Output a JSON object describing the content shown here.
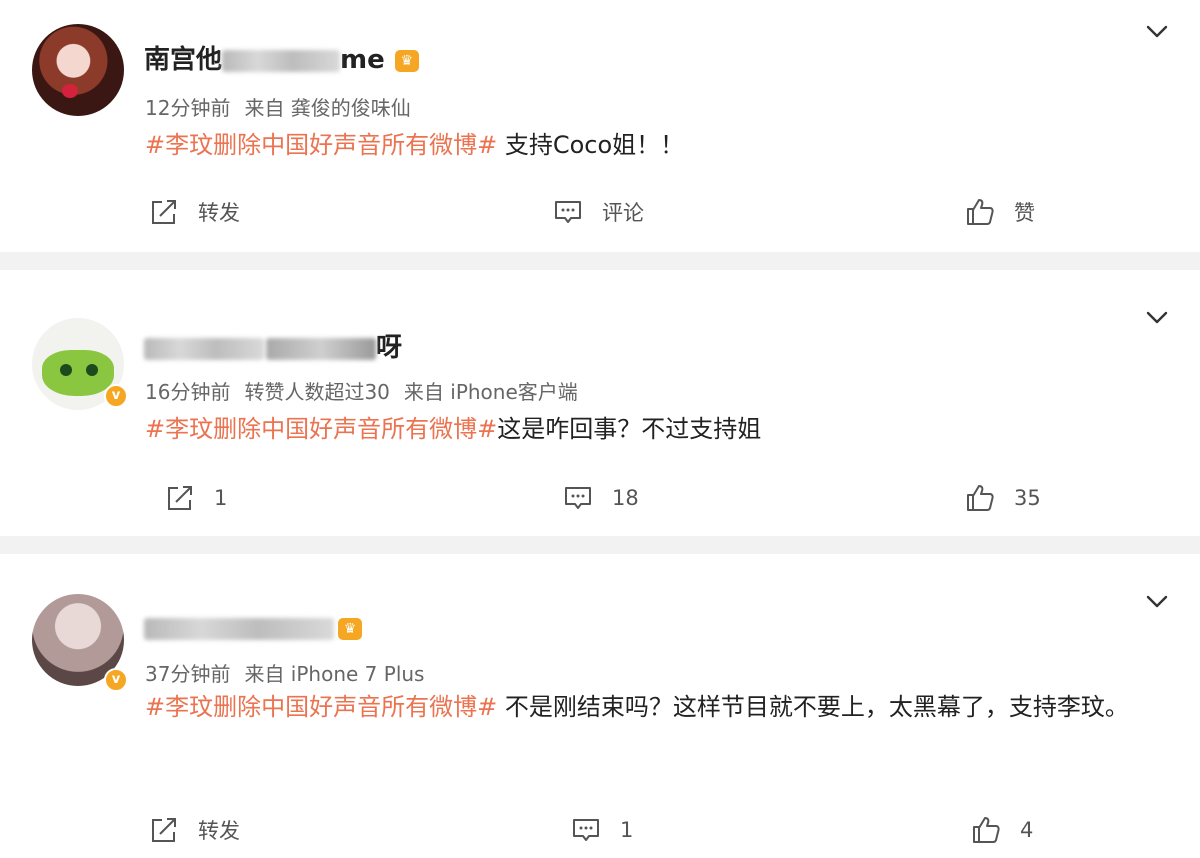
{
  "posts": [
    {
      "username_visible": "南宫他",
      "username_tail": "me",
      "time": "12分钟前",
      "source": "来自 龚俊的俊味仙",
      "topic": "#李玟删除中国好声音所有微博#",
      "text": " 支持Coco姐！！",
      "actions": {
        "share": "转发",
        "comment": "评论",
        "like": "赞"
      }
    },
    {
      "username_tail": "呀",
      "time": "16分钟前",
      "extra": "转赞人数超过30",
      "source": "来自 iPhone客户端",
      "topic": "#李玟删除中国好声音所有微博#",
      "text": "这是咋回事？不过支持姐",
      "actions": {
        "share": "1",
        "comment": "18",
        "like": "35"
      }
    },
    {
      "time": "37分钟前",
      "source": "来自 iPhone 7 Plus",
      "topic": "#李玟删除中国好声音所有微博#",
      "text": " 不是刚结束吗？这样节目就不要上，太黑幕了，支持李玟。",
      "actions": {
        "share": "转发",
        "comment": "1",
        "like": "4"
      }
    }
  ],
  "icons": {
    "more": "chevron-down-icon",
    "share": "share-icon",
    "comment": "comment-icon",
    "like": "thumbs-up-icon",
    "verified": "verified-badge-icon",
    "member": "member-crown-icon"
  },
  "colors": {
    "topic": "#eb7350",
    "badge": "#f5a623",
    "separator": "#f2f2f2"
  }
}
